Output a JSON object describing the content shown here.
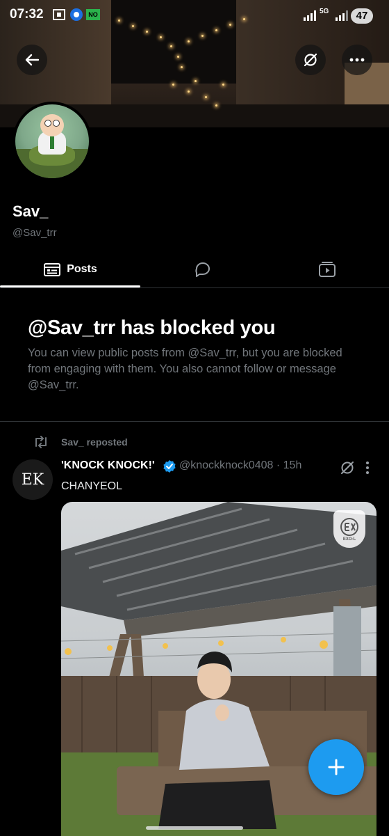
{
  "status_bar": {
    "time": "07:32",
    "badge": "NO",
    "network": "5G",
    "battery": "47"
  },
  "profile": {
    "display_name": "Sav_",
    "handle": "@Sav_trr"
  },
  "tabs": [
    {
      "label": "Posts",
      "icon": "posts-icon",
      "active": true
    },
    {
      "label": "",
      "icon": "replies-icon",
      "active": false
    },
    {
      "label": "",
      "icon": "media-icon",
      "active": false
    }
  ],
  "blocked": {
    "title": "@Sav_trr has blocked you",
    "body": "You can view public posts from @Sav_trr, but you are blocked from engaging with them. You also cannot follow or message @Sav_trr."
  },
  "post": {
    "repost_label": "Sav_ reposted",
    "author": "'KNOCK KNOCK!'",
    "verified": true,
    "handle_time": "@knockknock0408 · 15h",
    "text": "CHANYEOL",
    "avatar_text": "EK",
    "watermark": "EXO-L"
  },
  "colors": {
    "background": "#000000",
    "accent": "#1d9bf0",
    "muted_text": "#71767b",
    "divider": "#2f3336"
  }
}
